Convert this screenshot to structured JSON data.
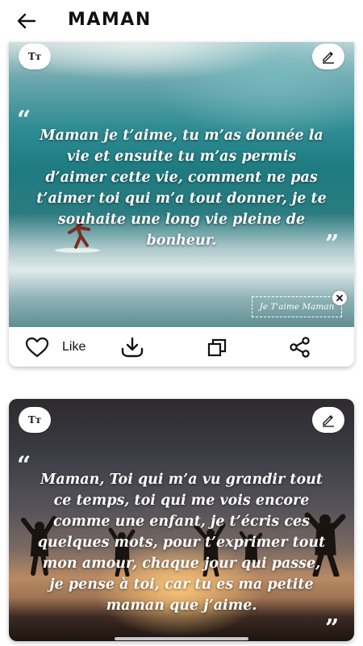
{
  "header": {
    "title": "MAMAN",
    "back_icon": "arrow-left-icon"
  },
  "cards": [
    {
      "quote_text": "Maman je t’aime, tu m’as donnée la vie et ensuite tu m’as permis d’aimer cette vie, comment ne pas t’aimer toi qui m’a tout donner, je te souhaite une long vie pleine de bonheur.",
      "font_button_label": "Tт",
      "open_quote": "“",
      "close_quote": "”",
      "signature": "Je T'aime Maman",
      "background_image": "surfer-wave-photo"
    },
    {
      "quote_text": "Maman, Toi qui m’a vu grandir tout ce temps, toi qui me vois encore comme une enfant, je t’écris ces quelques mots, pour t’exprimer tout mon amour, chaque jour qui passe, je pense à toi, car tu es ma petite maman que j’aime.",
      "font_button_label": "Tт",
      "open_quote": "“",
      "close_quote": "”",
      "background_image": "sunset-silhouettes-photo"
    }
  ],
  "actions": {
    "like_label": "Like",
    "like_icon": "heart-icon",
    "download_icon": "download-icon",
    "copy_icon": "copy-icon",
    "share_icon": "share-icon"
  },
  "colors": {
    "text": "#111111",
    "quote_text": "#ffffff",
    "card_bg": "#ffffff"
  }
}
